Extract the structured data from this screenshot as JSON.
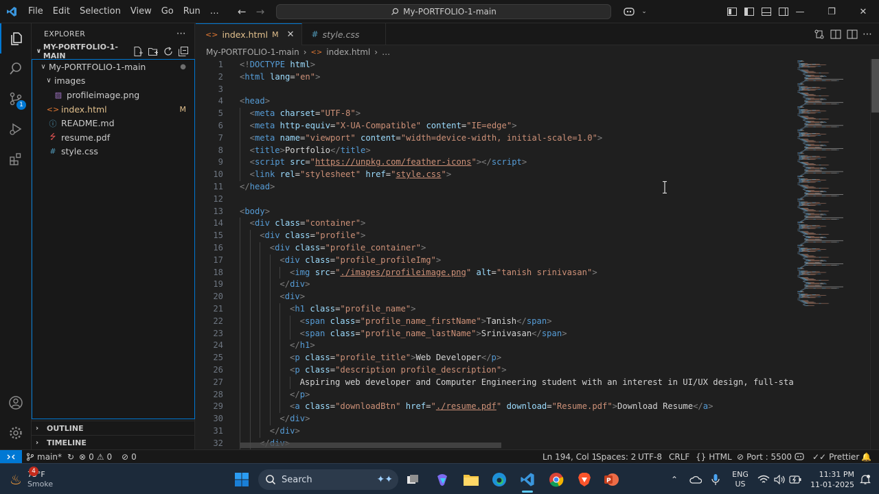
{
  "menu": [
    "File",
    "Edit",
    "Selection",
    "View",
    "Go",
    "Run",
    "…"
  ],
  "command_center": "My-PORTFOLIO-1-main",
  "sidebar": {
    "title": "EXPLORER",
    "folder": "MY-PORTFOLIO-1-MAIN",
    "tree": [
      {
        "name": "My-PORTFOLIO-1-main",
        "type": "folder",
        "status": "●",
        "depth": 0
      },
      {
        "name": "images",
        "type": "folder",
        "status": "",
        "depth": 1
      },
      {
        "name": "profileimage.png",
        "type": "image",
        "status": "",
        "depth": 2
      },
      {
        "name": "index.html",
        "type": "html",
        "status": "M",
        "depth": 1
      },
      {
        "name": "README.md",
        "type": "info",
        "status": "",
        "depth": 1
      },
      {
        "name": "resume.pdf",
        "type": "pdf",
        "status": "",
        "depth": 1
      },
      {
        "name": "style.css",
        "type": "css",
        "status": "",
        "depth": 1
      }
    ],
    "outline": "OUTLINE",
    "timeline": "TIMELINE"
  },
  "activity": {
    "scm_badge": "1"
  },
  "tabs": [
    {
      "label": "index.html",
      "status": "M",
      "active": true
    },
    {
      "label": "style.css",
      "status": "",
      "active": false
    }
  ],
  "breadcrumb": [
    "My-PORTFOLIO-1-main",
    "index.html",
    "…"
  ],
  "editor": {
    "lines": [
      {
        "n": "1",
        "indent": 0,
        "tokens": [
          [
            "b",
            "<!"
          ],
          [
            "g",
            "DOCTYPE"
          ],
          [
            "a",
            " html"
          ],
          [
            "b",
            ">"
          ]
        ]
      },
      {
        "n": "2",
        "indent": 0,
        "tokens": [
          [
            "b",
            "<"
          ],
          [
            "g",
            "html"
          ],
          [
            "a",
            " lang"
          ],
          [
            "t",
            "="
          ],
          [
            "s",
            "\"en\""
          ],
          [
            "b",
            ">"
          ]
        ]
      },
      {
        "n": "3",
        "indent": 0,
        "tokens": []
      },
      {
        "n": "4",
        "indent": 0,
        "tokens": [
          [
            "b",
            "<"
          ],
          [
            "g",
            "head"
          ],
          [
            "b",
            ">"
          ]
        ]
      },
      {
        "n": "5",
        "indent": 1,
        "tokens": [
          [
            "b",
            "<"
          ],
          [
            "g",
            "meta"
          ],
          [
            "a",
            " charset"
          ],
          [
            "t",
            "="
          ],
          [
            "s",
            "\"UTF-8\""
          ],
          [
            "b",
            ">"
          ]
        ]
      },
      {
        "n": "6",
        "indent": 1,
        "tokens": [
          [
            "b",
            "<"
          ],
          [
            "g",
            "meta"
          ],
          [
            "a",
            " http-equiv"
          ],
          [
            "t",
            "="
          ],
          [
            "s",
            "\"X-UA-Compatible\""
          ],
          [
            "a",
            " content"
          ],
          [
            "t",
            "="
          ],
          [
            "s",
            "\"IE=edge\""
          ],
          [
            "b",
            ">"
          ]
        ]
      },
      {
        "n": "7",
        "indent": 1,
        "tokens": [
          [
            "b",
            "<"
          ],
          [
            "g",
            "meta"
          ],
          [
            "a",
            " name"
          ],
          [
            "t",
            "="
          ],
          [
            "s",
            "\"viewport\""
          ],
          [
            "a",
            " content"
          ],
          [
            "t",
            "="
          ],
          [
            "s",
            "\"width=device-width, initial-scale=1.0\""
          ],
          [
            "b",
            ">"
          ]
        ]
      },
      {
        "n": "8",
        "indent": 1,
        "tokens": [
          [
            "b",
            "<"
          ],
          [
            "g",
            "title"
          ],
          [
            "b",
            ">"
          ],
          [
            "t",
            "Portfolio"
          ],
          [
            "b",
            "</"
          ],
          [
            "g",
            "title"
          ],
          [
            "b",
            ">"
          ]
        ]
      },
      {
        "n": "9",
        "indent": 1,
        "tokens": [
          [
            "b",
            "<"
          ],
          [
            "g",
            "script"
          ],
          [
            "a",
            " src"
          ],
          [
            "t",
            "="
          ],
          [
            "s",
            "\""
          ],
          [
            "l",
            "https://unpkg.com/feather-icons"
          ],
          [
            "s",
            "\""
          ],
          [
            "b",
            "></"
          ],
          [
            "g",
            "script"
          ],
          [
            "b",
            ">"
          ]
        ]
      },
      {
        "n": "10",
        "indent": 1,
        "tokens": [
          [
            "b",
            "<"
          ],
          [
            "g",
            "link"
          ],
          [
            "a",
            " rel"
          ],
          [
            "t",
            "="
          ],
          [
            "s",
            "\"stylesheet\""
          ],
          [
            "a",
            " href"
          ],
          [
            "t",
            "="
          ],
          [
            "s",
            "\""
          ],
          [
            "l",
            "style.css"
          ],
          [
            "s",
            "\""
          ],
          [
            "b",
            ">"
          ]
        ]
      },
      {
        "n": "11",
        "indent": 0,
        "tokens": [
          [
            "b",
            "</"
          ],
          [
            "g",
            "head"
          ],
          [
            "b",
            ">"
          ]
        ]
      },
      {
        "n": "12",
        "indent": 0,
        "tokens": []
      },
      {
        "n": "13",
        "indent": 0,
        "tokens": [
          [
            "b",
            "<"
          ],
          [
            "g",
            "body"
          ],
          [
            "b",
            ">"
          ]
        ]
      },
      {
        "n": "14",
        "indent": 1,
        "tokens": [
          [
            "b",
            "<"
          ],
          [
            "g",
            "div"
          ],
          [
            "a",
            " class"
          ],
          [
            "t",
            "="
          ],
          [
            "s",
            "\"container\""
          ],
          [
            "b",
            ">"
          ]
        ]
      },
      {
        "n": "15",
        "indent": 2,
        "tokens": [
          [
            "b",
            "<"
          ],
          [
            "g",
            "div"
          ],
          [
            "a",
            " class"
          ],
          [
            "t",
            "="
          ],
          [
            "s",
            "\"profile\""
          ],
          [
            "b",
            ">"
          ]
        ]
      },
      {
        "n": "16",
        "indent": 3,
        "tokens": [
          [
            "b",
            "<"
          ],
          [
            "g",
            "div"
          ],
          [
            "a",
            " class"
          ],
          [
            "t",
            "="
          ],
          [
            "s",
            "\"profile_container\""
          ],
          [
            "b",
            ">"
          ]
        ]
      },
      {
        "n": "17",
        "indent": 4,
        "tokens": [
          [
            "b",
            "<"
          ],
          [
            "g",
            "div"
          ],
          [
            "a",
            " class"
          ],
          [
            "t",
            "="
          ],
          [
            "s",
            "\"profile_profileImg\""
          ],
          [
            "b",
            ">"
          ]
        ]
      },
      {
        "n": "18",
        "indent": 5,
        "tokens": [
          [
            "b",
            "<"
          ],
          [
            "g",
            "img"
          ],
          [
            "a",
            " src"
          ],
          [
            "t",
            "="
          ],
          [
            "s",
            "\""
          ],
          [
            "l",
            "./images/profileimage.png"
          ],
          [
            "s",
            "\""
          ],
          [
            "a",
            " alt"
          ],
          [
            "t",
            "="
          ],
          [
            "s",
            "\"tanish srinivasan\""
          ],
          [
            "b",
            ">"
          ]
        ]
      },
      {
        "n": "19",
        "indent": 4,
        "tokens": [
          [
            "b",
            "</"
          ],
          [
            "g",
            "div"
          ],
          [
            "b",
            ">"
          ]
        ]
      },
      {
        "n": "20",
        "indent": 4,
        "tokens": [
          [
            "b",
            "<"
          ],
          [
            "g",
            "div"
          ],
          [
            "b",
            ">"
          ]
        ]
      },
      {
        "n": "21",
        "indent": 5,
        "tokens": [
          [
            "b",
            "<"
          ],
          [
            "g",
            "h1"
          ],
          [
            "a",
            " class"
          ],
          [
            "t",
            "="
          ],
          [
            "s",
            "\"profile_name\""
          ],
          [
            "b",
            ">"
          ]
        ]
      },
      {
        "n": "22",
        "indent": 6,
        "tokens": [
          [
            "b",
            "<"
          ],
          [
            "g",
            "span"
          ],
          [
            "a",
            " class"
          ],
          [
            "t",
            "="
          ],
          [
            "s",
            "\"profile_name_firstName\""
          ],
          [
            "b",
            ">"
          ],
          [
            "t",
            "Tanish"
          ],
          [
            "b",
            "</"
          ],
          [
            "g",
            "span"
          ],
          [
            "b",
            ">"
          ]
        ]
      },
      {
        "n": "23",
        "indent": 6,
        "tokens": [
          [
            "b",
            "<"
          ],
          [
            "g",
            "span"
          ],
          [
            "a",
            " class"
          ],
          [
            "t",
            "="
          ],
          [
            "s",
            "\"profile_name_lastName\""
          ],
          [
            "b",
            ">"
          ],
          [
            "t",
            "Srinivasan"
          ],
          [
            "b",
            "</"
          ],
          [
            "g",
            "span"
          ],
          [
            "b",
            ">"
          ]
        ]
      },
      {
        "n": "24",
        "indent": 5,
        "tokens": [
          [
            "b",
            "</"
          ],
          [
            "g",
            "h1"
          ],
          [
            "b",
            ">"
          ]
        ]
      },
      {
        "n": "25",
        "indent": 5,
        "tokens": [
          [
            "b",
            "<"
          ],
          [
            "g",
            "p"
          ],
          [
            "a",
            " class"
          ],
          [
            "t",
            "="
          ],
          [
            "s",
            "\"profile_title\""
          ],
          [
            "b",
            ">"
          ],
          [
            "t",
            "Web Developer"
          ],
          [
            "b",
            "</"
          ],
          [
            "g",
            "p"
          ],
          [
            "b",
            ">"
          ]
        ]
      },
      {
        "n": "26",
        "indent": 5,
        "tokens": [
          [
            "b",
            "<"
          ],
          [
            "g",
            "p"
          ],
          [
            "a",
            " class"
          ],
          [
            "t",
            "="
          ],
          [
            "s",
            "\"description profile_description\""
          ],
          [
            "b",
            ">"
          ]
        ]
      },
      {
        "n": "27",
        "indent": 6,
        "tokens": [
          [
            "t",
            "Aspiring web developer and Computer Engineering student with an interest in UI/UX design, full-stack"
          ]
        ]
      },
      {
        "n": "28",
        "indent": 5,
        "tokens": [
          [
            "b",
            "</"
          ],
          [
            "g",
            "p"
          ],
          [
            "b",
            ">"
          ]
        ]
      },
      {
        "n": "29",
        "indent": 5,
        "tokens": [
          [
            "b",
            "<"
          ],
          [
            "g",
            "a"
          ],
          [
            "a",
            " class"
          ],
          [
            "t",
            "="
          ],
          [
            "s",
            "\"downloadBtn\""
          ],
          [
            "a",
            " href"
          ],
          [
            "t",
            "="
          ],
          [
            "s",
            "\""
          ],
          [
            "l",
            "./resume.pdf"
          ],
          [
            "s",
            "\""
          ],
          [
            "a",
            " download"
          ],
          [
            "t",
            "="
          ],
          [
            "s",
            "\"Resume.pdf\""
          ],
          [
            "b",
            ">"
          ],
          [
            "t",
            "Download Resume"
          ],
          [
            "b",
            "</"
          ],
          [
            "g",
            "a"
          ],
          [
            "b",
            ">"
          ]
        ]
      },
      {
        "n": "30",
        "indent": 4,
        "tokens": [
          [
            "b",
            "</"
          ],
          [
            "g",
            "div"
          ],
          [
            "b",
            ">"
          ]
        ]
      },
      {
        "n": "31",
        "indent": 3,
        "tokens": [
          [
            "b",
            "</"
          ],
          [
            "g",
            "div"
          ],
          [
            "b",
            ">"
          ]
        ]
      },
      {
        "n": "32",
        "indent": 2,
        "tokens": [
          [
            "b",
            "</"
          ],
          [
            "g",
            "div"
          ],
          [
            "b",
            ">"
          ]
        ]
      }
    ]
  },
  "statusbar": {
    "branch": "main*",
    "errors": "0",
    "warnings": "0",
    "ports": "0",
    "position": "Ln 194, Col 1",
    "spaces": "Spaces: 2",
    "encoding": "UTF-8",
    "eol": "CRLF",
    "language": "HTML",
    "port": "Port : 5500",
    "prettier": "Prettier"
  },
  "taskbar": {
    "temperature": "73°F",
    "weather": "Smoke",
    "weather_badge": "4",
    "search": "Search",
    "lang": "ENG",
    "region": "US",
    "time": "11:31 PM",
    "date": "11-01-2025"
  },
  "colors": {
    "accent": "#0078d4",
    "modified": "#e2c08d"
  }
}
